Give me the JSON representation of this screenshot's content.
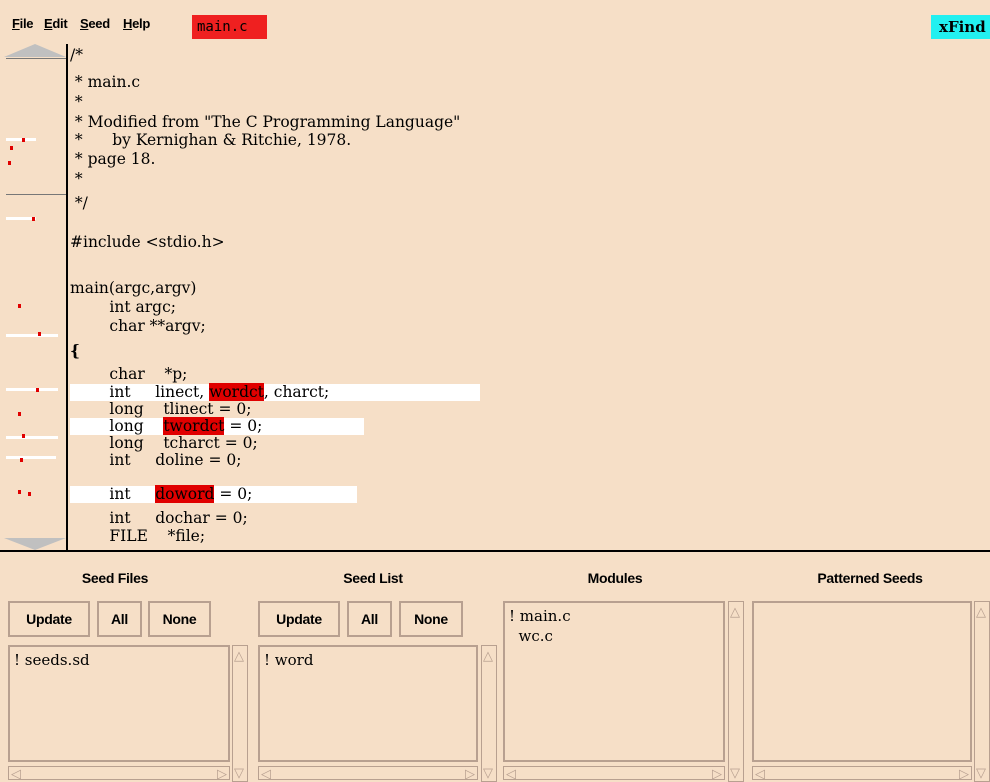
{
  "menu": {
    "items": [
      "File",
      "Edit",
      "Seed",
      "Help"
    ],
    "active_file": "main.c",
    "xfind_button": "xFind"
  },
  "code_lines": [
    "/*",
    " * main.c",
    " *",
    " * Modified from \"The C Programming Language\"",
    " *      by Kernighan & Ritchie, 1978.",
    " * page 18.",
    " *",
    " */",
    "",
    "#include <stdio.h>",
    "",
    "main(argc,argv)",
    "        int argc;",
    "        char **argv;",
    "{",
    "        char    *p;",
    "        int     linect, ",
    "        long    tlinect = 0;",
    "        long    ",
    "        long    tcharct = 0;",
    "        int     doline = 0;",
    "        int     ",
    "        int     dochar = 0;",
    "        FILE    *file;"
  ],
  "code_highlights": {
    "line16_hl": "wordct",
    "line16_rest": ", charct;",
    "line18_hl": "twordct",
    "line18_rest": " = 0;",
    "line21_hl": "doword",
    "line21_rest": " = 0;"
  },
  "colors": {
    "background": "#f6dfc7",
    "highlight": "#e00000",
    "file_tab": "#ef2020",
    "xfind": "#22f0f0"
  },
  "panels": {
    "seed_files": {
      "title": "Seed Files",
      "buttons": [
        "Update",
        "All",
        "None"
      ],
      "items": [
        "! seeds.sd"
      ]
    },
    "seed_list": {
      "title": "Seed List",
      "buttons": [
        "Update",
        "All",
        "None"
      ],
      "items": [
        "! word"
      ]
    },
    "modules": {
      "title": "Modules",
      "items": [
        "! main.c",
        "  wc.c"
      ]
    },
    "patterned_seeds": {
      "title": "Patterned Seeds",
      "items": []
    }
  }
}
